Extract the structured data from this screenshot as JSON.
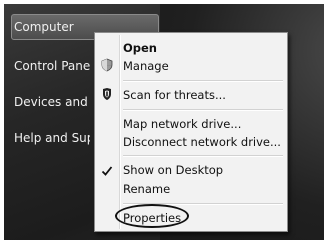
{
  "start_menu": {
    "items": [
      {
        "label": "Computer",
        "highlighted": true
      },
      {
        "label": "Control Panel",
        "highlighted": false
      },
      {
        "label": "Devices and Printers",
        "highlighted": false
      },
      {
        "label": "Help and Support",
        "highlighted": false
      }
    ]
  },
  "context_menu": {
    "groups": [
      [
        {
          "label": "Open",
          "bold": true,
          "icon": null
        },
        {
          "label": "Manage",
          "bold": false,
          "icon": "shield-icon"
        }
      ],
      [
        {
          "label": "Scan for threats...",
          "bold": false,
          "icon": "antivirus-icon"
        }
      ],
      [
        {
          "label": "Map network drive...",
          "bold": false,
          "icon": null
        },
        {
          "label": "Disconnect network drive...",
          "bold": false,
          "icon": null
        }
      ],
      [
        {
          "label": "Show on Desktop",
          "bold": false,
          "icon": "checkmark-icon"
        },
        {
          "label": "Rename",
          "bold": false,
          "icon": null
        }
      ],
      [
        {
          "label": "Properties",
          "bold": false,
          "icon": null,
          "circled": true
        }
      ]
    ]
  }
}
